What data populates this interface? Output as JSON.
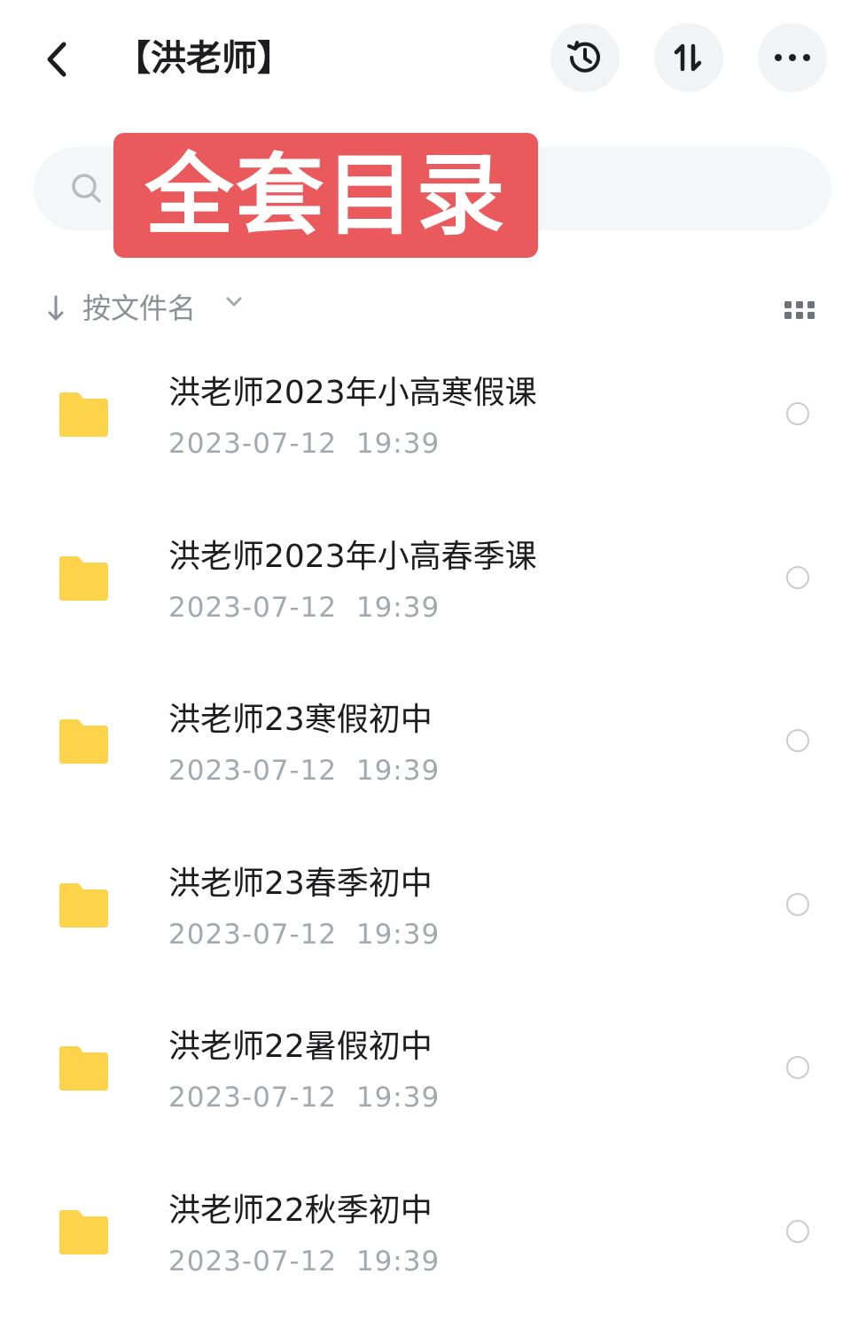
{
  "header": {
    "title": "【洪老师】",
    "back_icon": "chevron-left-icon",
    "actions": [
      "history-icon",
      "sort-toggle-icon",
      "more-icon"
    ]
  },
  "search": {
    "placeholder": "搜索"
  },
  "overlay_banner": {
    "text": "全套目录",
    "color": "#ea5a5c"
  },
  "sort": {
    "label": "按文件名",
    "direction": "descending"
  },
  "files": [
    {
      "name": "洪老师2023年小高寒假课",
      "date": "2023-07-12  19:39"
    },
    {
      "name": "洪老师2023年小高春季课",
      "date": "2023-07-12  19:39"
    },
    {
      "name": "洪老师23寒假初中",
      "date": "2023-07-12  19:39"
    },
    {
      "name": "洪老师23春季初中",
      "date": "2023-07-12  19:39"
    },
    {
      "name": "洪老师22暑假初中",
      "date": "2023-07-12  19:39"
    },
    {
      "name": "洪老师22秋季初中",
      "date": "2023-07-12  19:39"
    }
  ],
  "colors": {
    "folder": "#fdd34c",
    "accent_banner": "#ea5a5c",
    "text": "#1d1d1f",
    "muted": "#a4a8b0"
  }
}
